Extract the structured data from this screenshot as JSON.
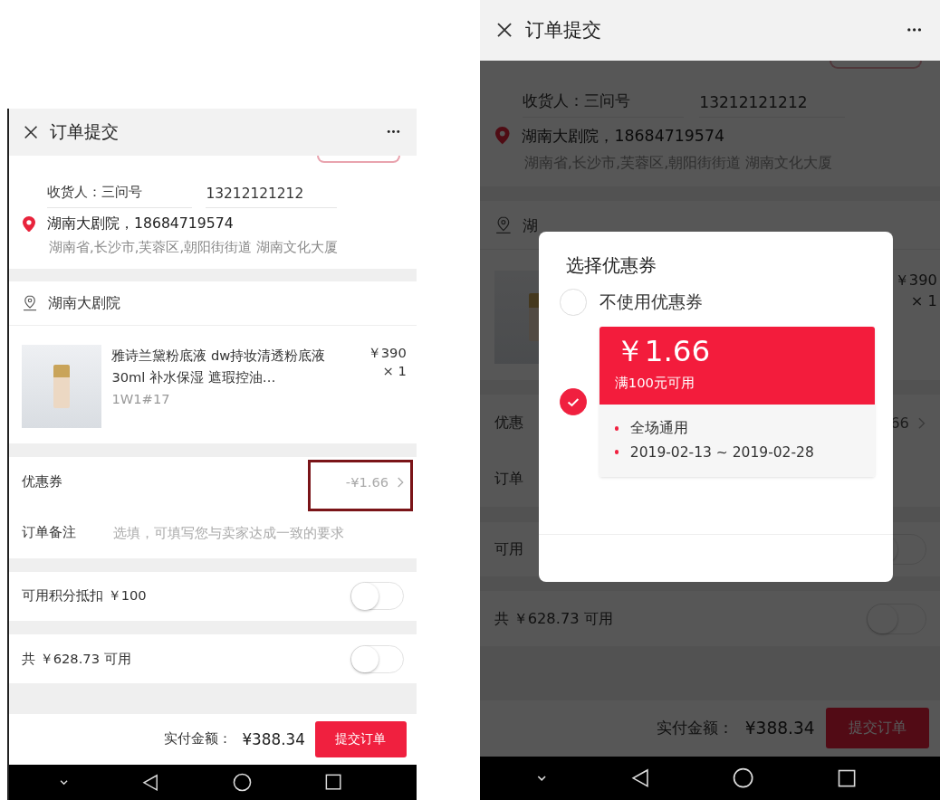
{
  "screens": [
    {
      "header": {
        "title": "订单提交"
      },
      "receiver": {
        "label": "收货人：",
        "name": "三问号",
        "phone": "13212121212"
      },
      "address": {
        "line1": "湖南大剧院，18684719574",
        "line2": "湖南省,长沙市,芙蓉区,朝阳街街道 湖南文化大厦"
      },
      "store": "湖南大剧院",
      "product": {
        "name": "雅诗兰黛粉底液 dw持妆清透粉底液30ml 补水保湿 遮瑕控油…",
        "sku": "1W1#17",
        "price": "￥390",
        "qty": "× 1"
      },
      "coupon": {
        "label": "优惠券",
        "value": "-¥1.66",
        "highlighted": true
      },
      "note": {
        "label": "订单备注",
        "placeholder": "选填，可填写您与卖家达成一致的要求"
      },
      "toggles": [
        {
          "label": "可用积分抵扣 ￥100",
          "on": false
        },
        {
          "label": "共 ￥628.73 可用",
          "on": false
        }
      ],
      "footer": {
        "label": "实付金额：",
        "amount": "¥388.34",
        "button": "提交订单"
      }
    },
    {
      "header": {
        "title": "订单提交"
      },
      "receiver": {
        "label": "收货人：",
        "name": "三问号",
        "phone": "13212121212"
      },
      "address": {
        "line1": "湖南大剧院，18684719574",
        "line2": "湖南省,长沙市,芙蓉区,朝阳街街道 湖南文化大厦"
      },
      "store": "湖",
      "product": {
        "price": "￥390",
        "qty": "× 1"
      },
      "coupon": {
        "label": "优惠",
        "value": "66"
      },
      "note": {
        "label": "订单"
      },
      "toggles": [
        {
          "label": "可用",
          "on": false
        },
        {
          "label": "共 ￥628.73 可用",
          "on": false
        }
      ],
      "footer": {
        "label": "实付金额：",
        "amount": "¥388.34",
        "button": "提交订单"
      },
      "dialog": {
        "title": "选择优惠券",
        "options": [
          {
            "kind": "none",
            "label": "不使用优惠券",
            "selected": false
          },
          {
            "kind": "coupon",
            "amount": "￥1.66",
            "condition": "满100元可用",
            "details": [
              "全场通用",
              "2019-02-13 ~ 2019-02-28"
            ],
            "selected": true
          }
        ]
      }
    }
  ]
}
